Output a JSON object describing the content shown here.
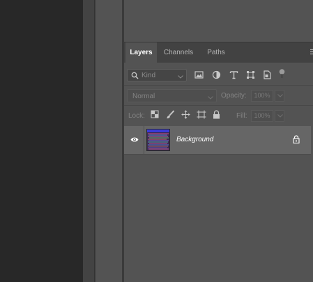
{
  "tabs": [
    {
      "label": "Layers",
      "active": true
    },
    {
      "label": "Channels",
      "active": false
    },
    {
      "label": "Paths",
      "active": false
    }
  ],
  "filter": {
    "kind_label": "Kind",
    "icons": [
      "pixel-filter-icon",
      "adjustment-filter-icon",
      "type-filter-icon",
      "shape-filter-icon",
      "smart-object-filter-icon",
      "filter-toggle-icon"
    ]
  },
  "blend": {
    "mode": "Normal",
    "opacity_label": "Opacity:",
    "opacity_value": "100%"
  },
  "lock": {
    "label": "Lock:",
    "icons": [
      "lock-transparent-pixels-icon",
      "lock-image-pixels-icon",
      "lock-position-icon",
      "lock-artboard-icon",
      "lock-all-icon"
    ],
    "fill_label": "Fill:",
    "fill_value": "100%"
  },
  "layers": [
    {
      "name": "Background",
      "visible": true,
      "locked": true,
      "selected": true
    }
  ],
  "colors": {
    "panel_bg": "#535353",
    "tabbar_bg": "#424242",
    "selected_layer_bg": "#666666",
    "canvas_bg": "#282828"
  }
}
